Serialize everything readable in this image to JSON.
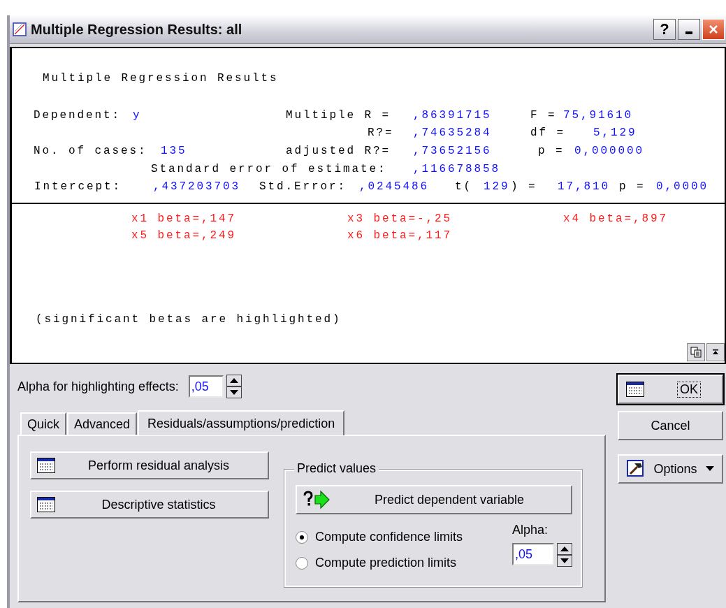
{
  "window": {
    "title": "Multiple Regression Results: all",
    "help": "?"
  },
  "results": {
    "heading": "Multiple Regression Results",
    "lines": [
      [
        {
          "text": "Dependent:",
          "kind": "label"
        },
        {
          "text": "y",
          "kind": "value"
        },
        {
          "text": "Multiple R =",
          "kind": "label"
        },
        {
          "text": ",86391715",
          "kind": "value"
        },
        {
          "text": "F =",
          "kind": "label"
        },
        {
          "text": "75,91610",
          "kind": "value"
        }
      ],
      [
        {
          "text": "R?=",
          "kind": "label"
        },
        {
          "text": ",74635284",
          "kind": "value"
        },
        {
          "text": "df =",
          "kind": "label"
        },
        {
          "text": "5,129",
          "kind": "value"
        }
      ],
      [
        {
          "text": "No. of cases:",
          "kind": "label"
        },
        {
          "text": "135",
          "kind": "value"
        },
        {
          "text": "adjusted R?=",
          "kind": "label"
        },
        {
          "text": ",73652156",
          "kind": "value"
        },
        {
          "text": "p =",
          "kind": "label"
        },
        {
          "text": "0,000000",
          "kind": "value"
        }
      ],
      [
        {
          "text": "Standard error of estimate:",
          "kind": "label"
        },
        {
          "text": ",116678858",
          "kind": "value"
        }
      ],
      [
        {
          "text": "Intercept:",
          "kind": "label"
        },
        {
          "text": ",437203703",
          "kind": "value"
        },
        {
          "text": "Std.Error:",
          "kind": "label"
        },
        {
          "text": ",0245486",
          "kind": "value"
        },
        {
          "text": "t(",
          "kind": "label"
        },
        {
          "text": "129",
          "kind": "value"
        },
        {
          "text": ") =",
          "kind": "label"
        },
        {
          "text": "17,810",
          "kind": "value"
        },
        {
          "text": "p =",
          "kind": "label"
        },
        {
          "text": "0,0000",
          "kind": "value"
        }
      ]
    ],
    "betas": [
      {
        "text": "x1 beta=,147",
        "significant": true
      },
      {
        "text": "x3 beta=-,25",
        "significant": true
      },
      {
        "text": "x4 beta=,897",
        "significant": true
      },
      {
        "text": "x5 beta=,249",
        "significant": true
      },
      {
        "text": "x6 beta=,117",
        "significant": true
      }
    ],
    "footnote": "(significant betas are highlighted)"
  },
  "alpha": {
    "label": "Alpha for highlighting effects:",
    "value": ",05"
  },
  "tabs": [
    {
      "label": "Quick",
      "selected": false
    },
    {
      "label": "Advanced",
      "selected": false
    },
    {
      "label": "Residuals/assumptions/prediction",
      "selected": true
    }
  ],
  "panel": {
    "buttons": [
      "Perform residual analysis",
      "Descriptive statistics"
    ],
    "predict": {
      "title": "Predict values",
      "button": "Predict dependent variable",
      "options": [
        {
          "label": "Compute confidence limits",
          "selected": true
        },
        {
          "label": "Compute prediction limits",
          "selected": false
        }
      ],
      "alpha_label": "Alpha:",
      "alpha_value": ",05"
    }
  },
  "actions": [
    {
      "label": "OK",
      "kind": "ok",
      "default": true
    },
    {
      "label": "Cancel",
      "kind": "plain",
      "default": false
    },
    {
      "label": "Options",
      "kind": "menu",
      "default": false
    }
  ]
}
